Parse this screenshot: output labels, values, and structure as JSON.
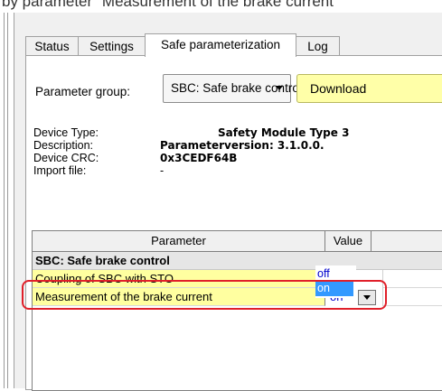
{
  "caption": "by parameter \"Measurement of the brake current\"",
  "tabs": [
    {
      "label": "Status"
    },
    {
      "label": "Settings"
    },
    {
      "label": "Safe parameterization"
    },
    {
      "label": "Log"
    }
  ],
  "parameter_group": {
    "label": "Parameter group:",
    "selected": "SBC: Safe brake control",
    "download_label": "Download"
  },
  "device_info": {
    "device_type_label": "Device Type:",
    "device_type_value": "Safety Module Type 3",
    "description_label": "Description:",
    "description_value": "Parameterversion: 3.1.0.0.",
    "crc_label": "Device CRC:",
    "crc_value": "0x3CEDF64B",
    "import_label": "Import file:",
    "import_value": "-"
  },
  "grid": {
    "columns": [
      "Parameter",
      "Value"
    ],
    "group_title": "SBC: Safe brake control",
    "rows": [
      {
        "parameter": "Coupling of SBC with STO",
        "value": "off"
      },
      {
        "parameter": "Measurement of the brake current",
        "value": "on"
      }
    ],
    "dropdown_options": [
      "off",
      "on"
    ],
    "dropdown_selected": "on"
  },
  "colors": {
    "param_cell_bg": "#ffffa0",
    "download_bg": "#ffffa8",
    "highlight_border": "#e0202a",
    "selected_option_bg": "#3399ff"
  }
}
